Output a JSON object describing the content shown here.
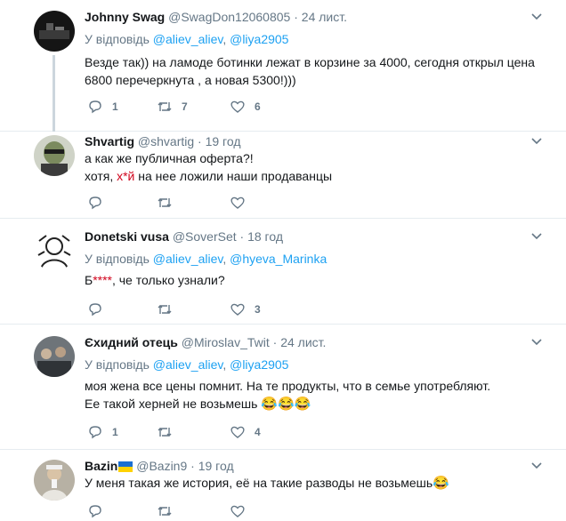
{
  "tweets": [
    {
      "name": "Johnny Swag",
      "handle": "@SwagDon12060805",
      "time": "24 лист.",
      "reply_prefix": "У відповідь",
      "mentions": [
        "@aliev_aliev",
        "@liya2905"
      ],
      "text_lines": [
        "Везде так)) на ламоде ботинки лежат в корзине за 4000, сегодня открыл цена",
        "6800 перечеркнута , а новая 5300!)))"
      ],
      "replies": "1",
      "retweets": "7",
      "likes": "6"
    },
    {
      "name": "Shvartig",
      "handle": "@shvartig",
      "time": "19 год",
      "text_lines": [
        "а как же публичная оферта?!",
        "хотя, ",
        "на нее ложили наши продаванцы"
      ],
      "censor_mark": "х*й",
      "replies": "",
      "retweets": "",
      "likes": ""
    },
    {
      "name": "Donetski vusa",
      "handle": "@SoverSet",
      "time": "18 год",
      "reply_prefix": "У відповідь",
      "mentions": [
        "@aliev_aliev",
        "@hyeva_Marinka"
      ],
      "text_start": "Б",
      "censor_mark": "****",
      "text_rest": ", че только узнали?",
      "replies": "",
      "retweets": "",
      "likes": "3"
    },
    {
      "name": "Єхидний отець",
      "handle": "@Miroslav_Twit",
      "time": "24 лист.",
      "reply_prefix": "У відповідь",
      "mentions": [
        "@aliev_aliev",
        "@liya2905"
      ],
      "text_lines": [
        "моя жена все цены помнит. На те продукты, что в семье употребляют.",
        "Ее такой херней не возьмешь "
      ],
      "emojis": "😂😂😂",
      "replies": "1",
      "retweets": "",
      "likes": "4"
    },
    {
      "name": "Bazin",
      "handle": "@Bazin9",
      "time": "19 год",
      "text_lines": [
        "У меня такая же история, её на такие разводы не возьмешь"
      ],
      "emojis": "😂",
      "replies": "",
      "retweets": "",
      "likes": ""
    }
  ],
  "colors": {
    "link": "#1da1f2",
    "muted": "#657786",
    "thread": "#ccd6dd"
  },
  "icons": [
    "reply-icon",
    "retweet-icon",
    "like-icon",
    "caret-down-icon",
    "ukraine-flag-icon"
  ]
}
